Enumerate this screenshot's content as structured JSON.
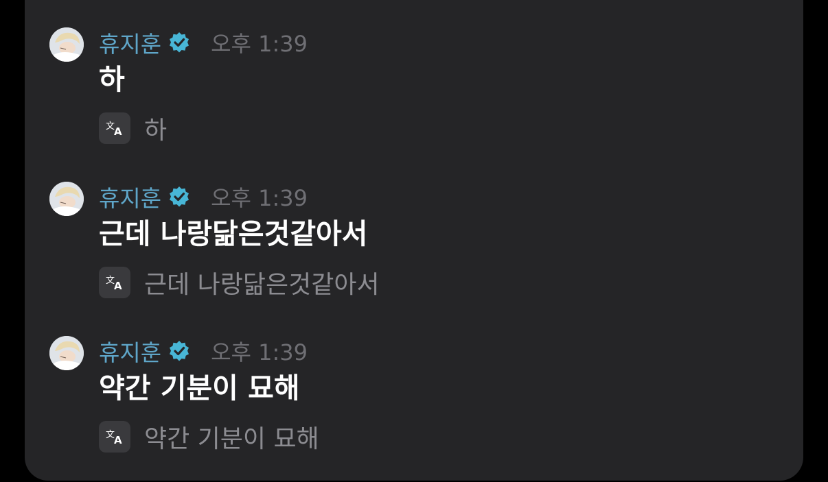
{
  "colors": {
    "card_bg": "#252527",
    "name": "#5fa6c9",
    "verified_badge": "#48b6d6",
    "time": "#6f6f74",
    "body_text": "#ffffff",
    "translated_text": "#8c8c91",
    "translate_button_bg": "#3a3a3d"
  },
  "messages": [
    {
      "author": "휴지훈",
      "verified": true,
      "time": "오후 1:39",
      "text": "하",
      "translation": "하",
      "translate_icon": "translate-icon"
    },
    {
      "author": "휴지훈",
      "verified": true,
      "time": "오후 1:39",
      "text": "근데 나랑닮은것같아서",
      "translation": "근데 나랑닮은것같아서",
      "translate_icon": "translate-icon"
    },
    {
      "author": "휴지훈",
      "verified": true,
      "time": "오후 1:39",
      "text": "약간 기분이 묘해",
      "translation": "약간 기분이 묘해",
      "translate_icon": "translate-icon"
    }
  ]
}
